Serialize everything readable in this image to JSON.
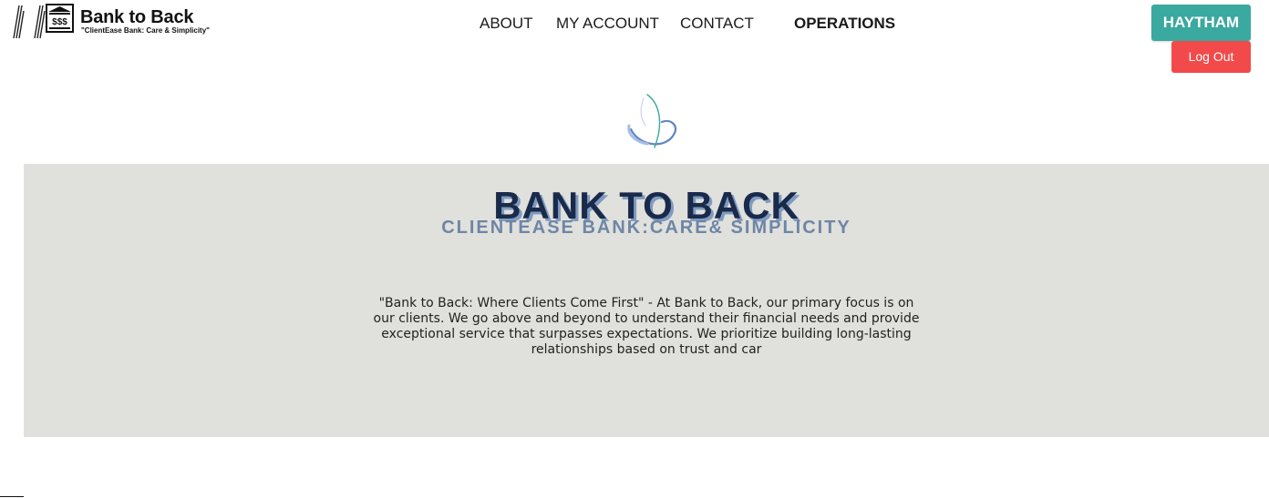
{
  "logo": {
    "title": "Bank to Back",
    "tagline": "\"ClientEase Bank:  Care & Simplicity\"",
    "icon_text": "$$$",
    "icon": "bank-building-icon"
  },
  "nav": {
    "items": [
      {
        "label": "ABOUT"
      },
      {
        "label": "MY ACCOUNT"
      },
      {
        "label": "CONTACT"
      },
      {
        "label": "OPERATIONS"
      }
    ]
  },
  "user": {
    "name": "HAYTHAM",
    "logout_label": "Log Out"
  },
  "emblem": {
    "icon": "orbit-emblem-icon"
  },
  "hero": {
    "title": "BANK TO BACK",
    "subtitle": "CLIENTEASE BANK:CARE& SIMPLICITY",
    "text": "\"Bank to Back: Where Clients Come First\" - At Bank to Back, our primary focus is on our clients. We go above and beyond to understand their financial needs and provide exceptional service that surpasses expectations. We prioritize building long-lasting relationships based on trust and car"
  },
  "colors": {
    "user_button": "#3aa99f",
    "logout_button": "#f24a4a",
    "hero_background": "#e0e0dc",
    "hero_title": "#1a2a4a",
    "hero_subtitle": "#6e86a6"
  }
}
